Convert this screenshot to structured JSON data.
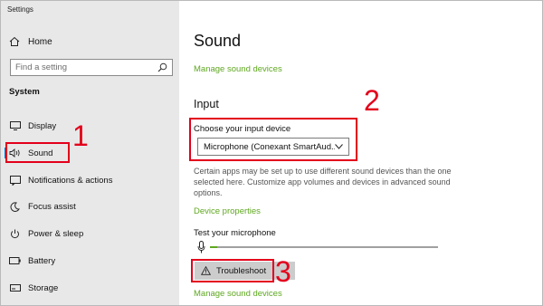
{
  "window": {
    "title": "Settings"
  },
  "sidebar": {
    "home_label": "Home",
    "search_placeholder": "Find a setting",
    "section_label": "System",
    "items": [
      {
        "label": "Display",
        "icon": "display-icon"
      },
      {
        "label": "Sound",
        "icon": "speaker-icon",
        "active": true
      },
      {
        "label": "Notifications & actions",
        "icon": "notifications-icon"
      },
      {
        "label": "Focus assist",
        "icon": "moon-icon"
      },
      {
        "label": "Power & sleep",
        "icon": "power-icon"
      },
      {
        "label": "Battery",
        "icon": "battery-icon"
      },
      {
        "label": "Storage",
        "icon": "storage-icon"
      }
    ]
  },
  "main": {
    "title": "Sound",
    "manage_link_top": "Manage sound devices",
    "input_heading": "Input",
    "choose_label": "Choose your input device",
    "device_value": "Microphone (Conexant SmartAud...",
    "description": "Certain apps may be set up to use different sound devices than the one selected here. Customize app volumes and devices in advanced sound options.",
    "device_properties_link": "Device properties",
    "test_label": "Test your microphone",
    "mic_level": 0.03,
    "troubleshoot_label": "Troubleshoot",
    "manage_link_bottom": "Manage sound devices"
  },
  "annotations": {
    "n1": "1",
    "n2": "2",
    "n3": "3"
  },
  "colors": {
    "accent_link": "#5fa820",
    "annotation_red": "#e3001b",
    "sidebar_bg": "#e8e8e8"
  }
}
